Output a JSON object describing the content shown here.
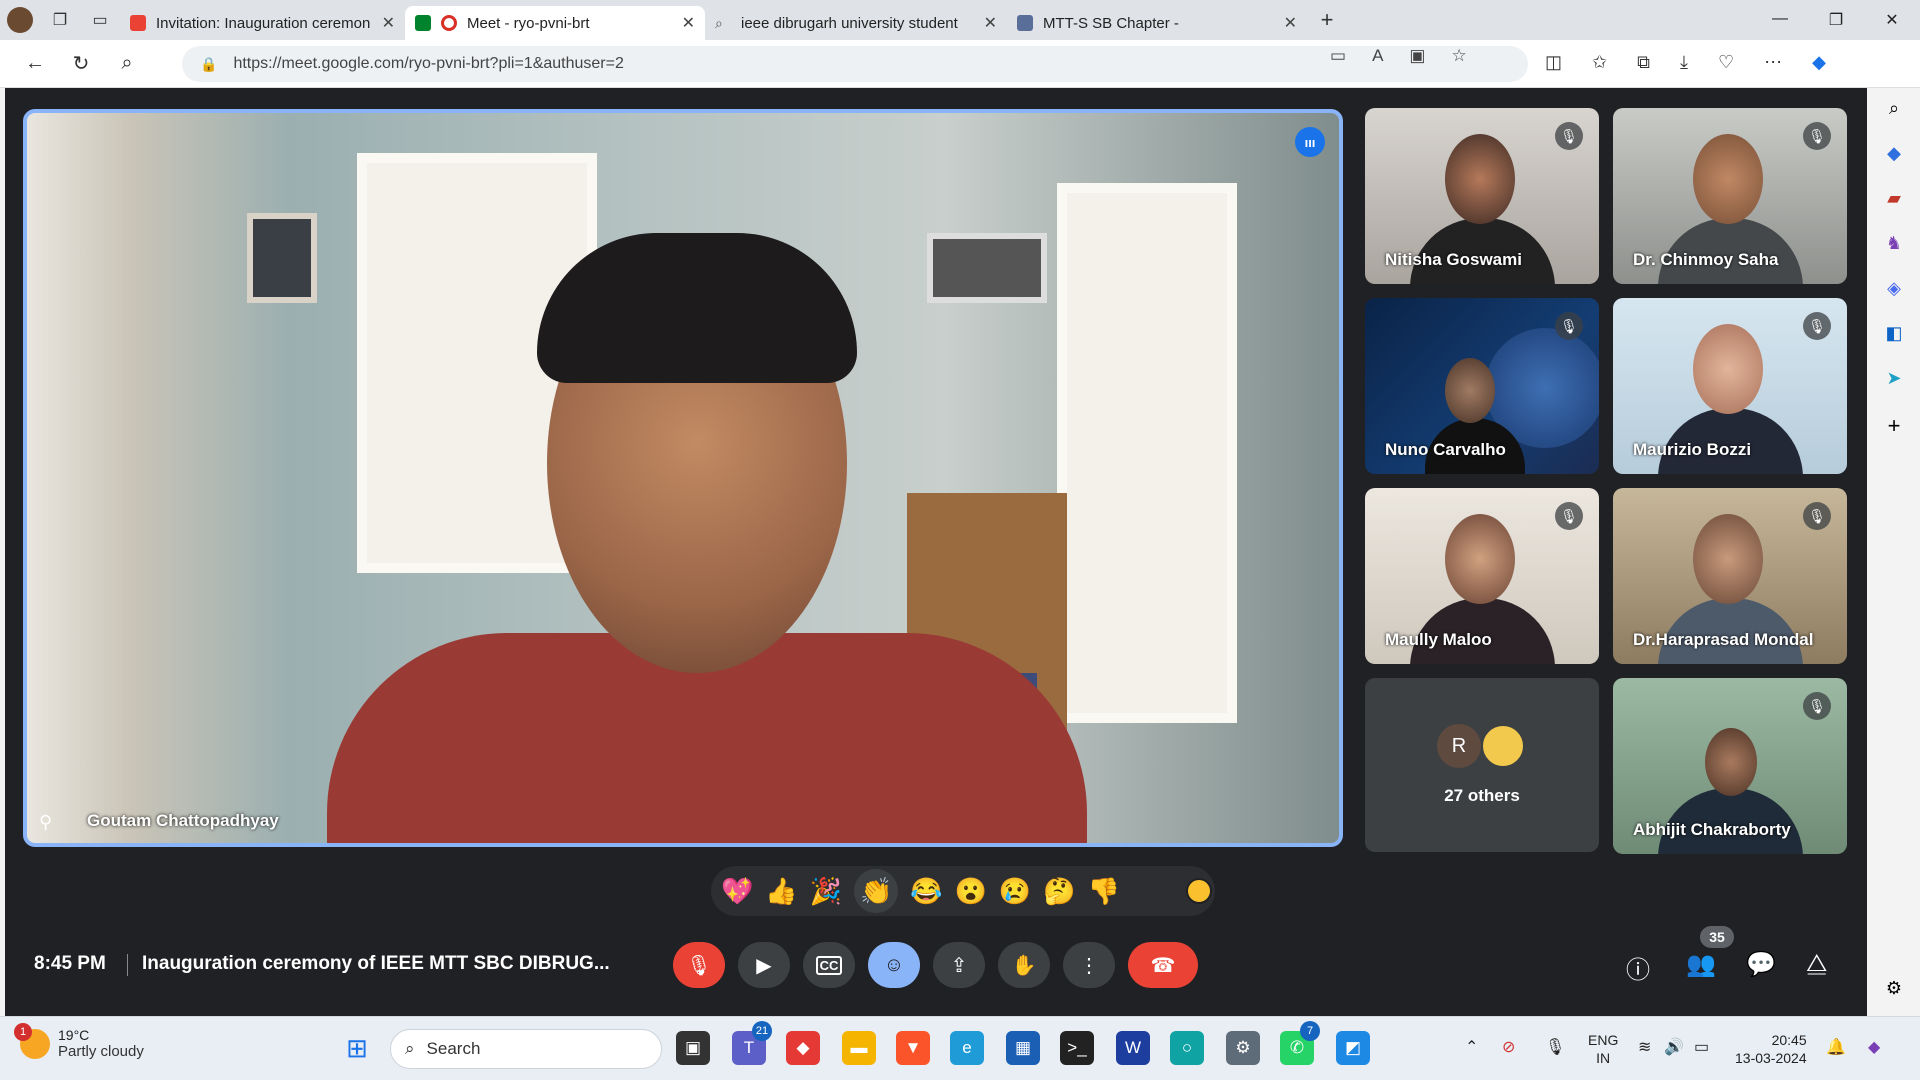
{
  "browser": {
    "tabs": [
      {
        "title": "Invitation: Inauguration ceremon",
        "active": false
      },
      {
        "title": "Meet - ryo-pvni-brt",
        "active": true
      },
      {
        "title": "ieee dibrugarh university student",
        "active": false
      },
      {
        "title": "MTT-S SB Chapter -",
        "active": false
      }
    ],
    "url": "https://meet.google.com/ryo-pvni-brt?pli=1&authuser=2"
  },
  "meet": {
    "main_speaker": "Goutam Chattopadhyay",
    "participants": [
      "Nitisha Goswami",
      "Dr. Chinmoy Saha",
      "Nuno Carvalho",
      "Maurizio Bozzi",
      "Maully Maloo",
      "Dr.Haraprasad Mondal",
      "Abhijit Chakraborty"
    ],
    "others": {
      "initial": "R",
      "label": "27 others"
    },
    "reactions": [
      "💖",
      "👍",
      "🎉",
      "👏",
      "😂",
      "😮",
      "😢",
      "🤔",
      "👎"
    ],
    "time": "8:45 PM",
    "title": "Inauguration ceremony of IEEE MTT SBC DIBRUG...",
    "people_count": "35"
  },
  "taskbar": {
    "weather_temp": "19°C",
    "weather_desc": "Partly cloudy",
    "weather_badge": "1",
    "search_label": "Search",
    "teams_badge": "21",
    "whatsapp_badge": "7",
    "lang_top": "ENG",
    "lang_bottom": "IN",
    "clock_time": "20:45",
    "clock_date": "13-03-2024"
  }
}
